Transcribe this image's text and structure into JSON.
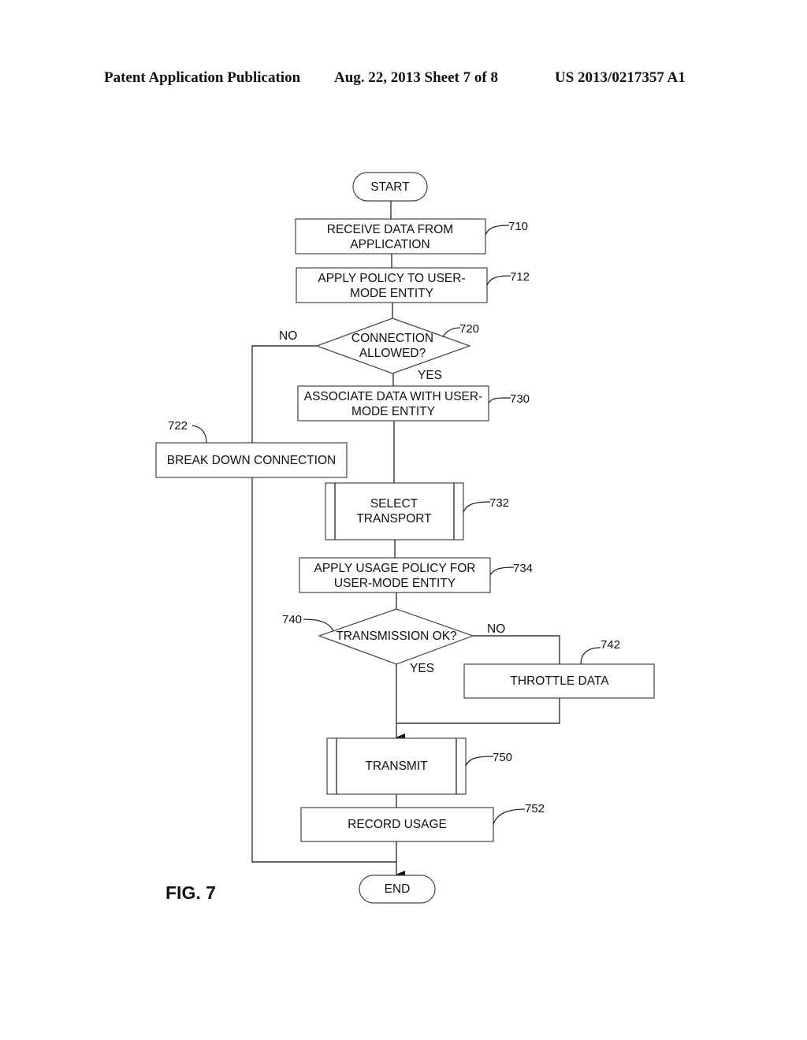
{
  "header": {
    "publication": "Patent Application Publication",
    "date_sheet": "Aug. 22, 2013  Sheet 7 of 8",
    "number": "US 2013/0217357 A1"
  },
  "figure": {
    "label": "FIG. 7",
    "terminals": {
      "start": "START",
      "end": "END"
    },
    "steps": {
      "s710": {
        "ref": "710",
        "line1": "RECEIVE DATA FROM",
        "line2": "APPLICATION"
      },
      "s712": {
        "ref": "712",
        "line1": "APPLY POLICY TO USER-",
        "line2": "MODE ENTITY"
      },
      "s720": {
        "ref": "720",
        "line1": "CONNECTION",
        "line2": "ALLOWED?",
        "no": "NO",
        "yes": "YES"
      },
      "s722": {
        "ref": "722",
        "line1": "BREAK DOWN CONNECTION"
      },
      "s730": {
        "ref": "730",
        "line1": "ASSOCIATE DATA WITH USER-",
        "line2": "MODE ENTITY"
      },
      "s732": {
        "ref": "732",
        "line1": "SELECT",
        "line2": "TRANSPORT"
      },
      "s734": {
        "ref": "734",
        "line1": "APPLY USAGE POLICY FOR",
        "line2": "USER-MODE ENTITY"
      },
      "s740": {
        "ref": "740",
        "line1": "TRANSMISSION OK?",
        "no": "NO",
        "yes": "YES"
      },
      "s742": {
        "ref": "742",
        "line1": "THROTTLE DATA"
      },
      "s750": {
        "ref": "750",
        "line1": "TRANSMIT"
      },
      "s752": {
        "ref": "752",
        "line1": "RECORD USAGE"
      }
    }
  }
}
